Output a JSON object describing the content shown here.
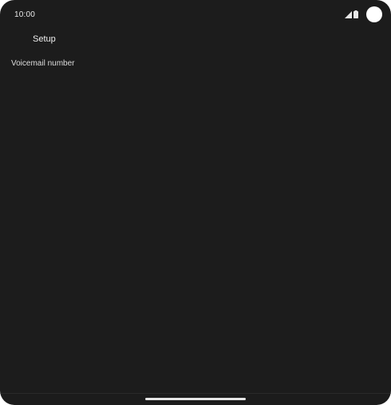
{
  "status_bar": {
    "time": "10:00",
    "signal_icon": "cell-signal-icon",
    "battery_icon": "battery-icon"
  },
  "app_bar": {
    "title": "Setup"
  },
  "settings": {
    "items": [
      {
        "label": "Voicemail number"
      }
    ]
  },
  "colors": {
    "background": "#1c1c1c",
    "text_primary": "#eeeeee",
    "text_secondary": "#dcdcdc"
  }
}
